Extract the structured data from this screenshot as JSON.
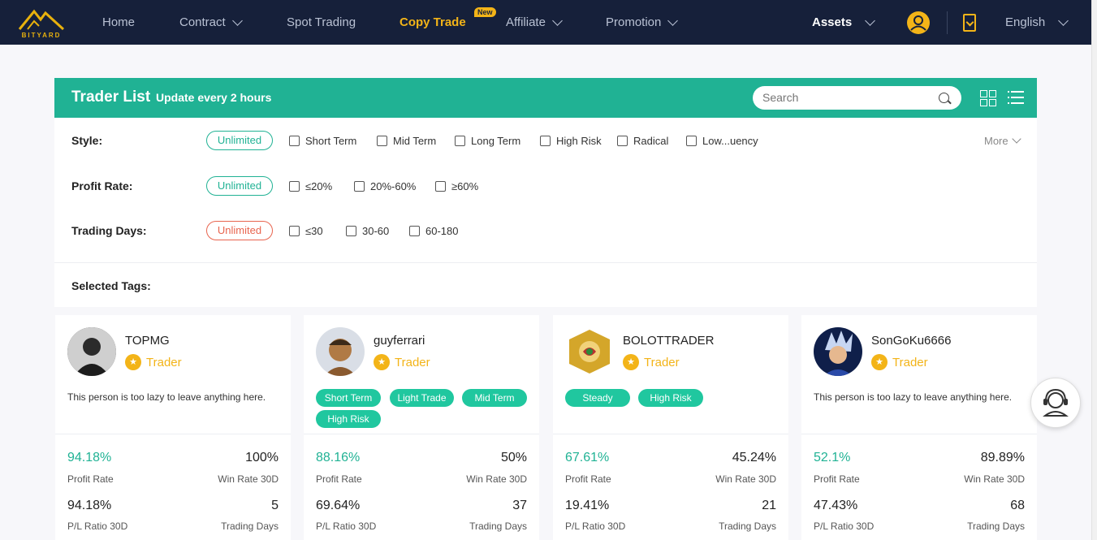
{
  "nav": {
    "logo_text": "BITYARD",
    "items": [
      {
        "label": "Home"
      },
      {
        "label": "Contract"
      },
      {
        "label": "Spot Trading"
      },
      {
        "label": "Copy Trade"
      },
      {
        "label": "Affiliate"
      },
      {
        "label": "Promotion"
      }
    ],
    "new_badge": "New",
    "assets": "Assets",
    "language": "English"
  },
  "panel": {
    "title": "Trader List",
    "subtitle": "Update every 2 hours",
    "search_placeholder": "Search",
    "filters": {
      "style": {
        "label": "Style:",
        "selected": "Unlimited",
        "options": [
          "Short Term",
          "Mid Term",
          "Long Term",
          "High Risk",
          "Radical",
          "Low...uency"
        ]
      },
      "profit_rate": {
        "label": "Profit Rate:",
        "selected": "Unlimited",
        "options": [
          "≤20%",
          "20%-60%",
          "≥60%"
        ]
      },
      "trading_days": {
        "label": "Trading Days:",
        "selected": "Unlimited",
        "options": [
          "≤30",
          "30-60",
          "60-180"
        ]
      }
    },
    "more": "More",
    "selected_tags_label": "Selected Tags:"
  },
  "traders": [
    {
      "name": "TOPMG",
      "role": "Trader",
      "bio": "This person is too lazy to leave anything here.",
      "tags": [],
      "profit_rate": "94.18%",
      "profit_rate_label": "Profit Rate",
      "win_rate": "100%",
      "win_rate_label": "Win Rate 30D",
      "pl_ratio": "94.18%",
      "pl_ratio_label": "P/L Ratio 30D",
      "trading_days": "5",
      "trading_days_label": "Trading Days"
    },
    {
      "name": "guyferrari",
      "role": "Trader",
      "bio": "",
      "tags": [
        "Short Term",
        "Light Trade",
        "Mid Term",
        "High Risk"
      ],
      "profit_rate": "88.16%",
      "profit_rate_label": "Profit Rate",
      "win_rate": "50%",
      "win_rate_label": "Win Rate 30D",
      "pl_ratio": "69.64%",
      "pl_ratio_label": "P/L Ratio 30D",
      "trading_days": "37",
      "trading_days_label": "Trading Days"
    },
    {
      "name": "BOLOTTRADER",
      "role": "Trader",
      "bio": "",
      "tags": [
        "Steady",
        "High Risk"
      ],
      "profit_rate": "67.61%",
      "profit_rate_label": "Profit Rate",
      "win_rate": "45.24%",
      "win_rate_label": "Win Rate 30D",
      "pl_ratio": "19.41%",
      "pl_ratio_label": "P/L Ratio 30D",
      "trading_days": "21",
      "trading_days_label": "Trading Days"
    },
    {
      "name": "SonGoKu6666",
      "role": "Trader",
      "bio": "This person is too lazy to leave anything here.",
      "tags": [],
      "profit_rate": "52.1%",
      "profit_rate_label": "Profit Rate",
      "win_rate": "89.89%",
      "win_rate_label": "Win Rate 30D",
      "pl_ratio": "47.43%",
      "pl_ratio_label": "P/L Ratio 30D",
      "trading_days": "68",
      "trading_days_label": "Trading Days"
    }
  ],
  "colors": {
    "nav_bg": "#16203a",
    "accent_teal": "#20b294",
    "accent_gold": "#f3b418",
    "tag_green": "#20c79f",
    "unlimited_red": "#e8644e"
  }
}
